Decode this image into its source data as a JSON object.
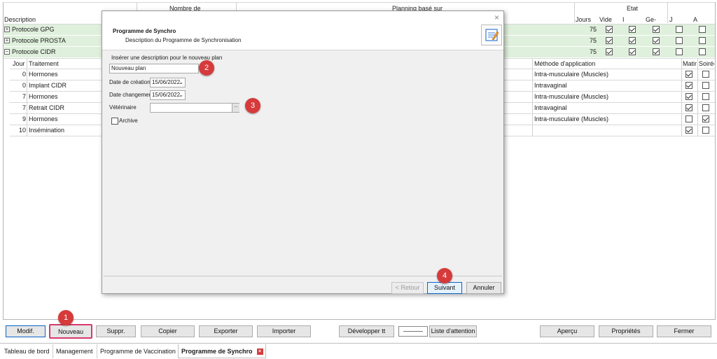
{
  "grid": {
    "top_headers": {
      "nombre_de": "Nombre de",
      "planning_base_sur": "Planning basé sur",
      "etat": "Etat"
    },
    "columns": {
      "description": "Description",
      "jours": "Jours",
      "vide": "Vide",
      "i": "I",
      "ge": "Ge-",
      "j": "J",
      "a": "A"
    },
    "protocols": [
      {
        "name": "Protocole GPG",
        "expander": "+",
        "jours": "75",
        "vide": true,
        "i": true,
        "ge": true,
        "j": false,
        "a": false
      },
      {
        "name": "Protocole PROSTA",
        "expander": "+",
        "jours": "75",
        "vide": true,
        "i": true,
        "ge": true,
        "j": false,
        "a": false
      },
      {
        "name": "Protocole CIDR",
        "expander": "−",
        "jours": "75",
        "vide": true,
        "i": true,
        "ge": true,
        "j": false,
        "a": false
      }
    ],
    "sub_columns": {
      "jour": "Jour",
      "traitement": "Traitement",
      "methode": "Méthode d'application",
      "matin": "Matin",
      "soiree": "Soirée"
    },
    "treatments": [
      {
        "jour": "0",
        "traitement": "Hormones",
        "methode": "Intra-musculaire (Muscles)",
        "matin": true,
        "soiree": false
      },
      {
        "jour": "0",
        "traitement": "Implant CIDR",
        "methode": "Intravaginal",
        "matin": true,
        "soiree": false
      },
      {
        "jour": "7",
        "traitement": "Hormones",
        "methode": "Intra-musculaire (Muscles)",
        "matin": true,
        "soiree": false
      },
      {
        "jour": "7",
        "traitement": "Retrait CIDR",
        "methode": "Intravaginal",
        "matin": true,
        "soiree": false
      },
      {
        "jour": "9",
        "traitement": "Hormones",
        "methode": "Intra-musculaire (Muscles)",
        "matin": false,
        "soiree": true
      },
      {
        "jour": "10",
        "traitement": "Insémination",
        "methode": "",
        "matin": true,
        "soiree": false
      }
    ]
  },
  "dialog": {
    "title": "Programme de Synchro",
    "subtitle": "Description du Programme de Synchronisation",
    "close_glyph": "×",
    "prompt": "Insérer une description pour le nouveau plan",
    "description_value": "Nouveau plan",
    "date_creation_label": "Date de création",
    "date_creation_value": "15/06/2022",
    "date_changement_label": "Date changement",
    "date_changement_value": "15/06/2022",
    "veterinaire_label": "Vétérinaire",
    "veterinaire_value": "",
    "browse_glyph": "...",
    "archive_label": "Archive",
    "btn_retour": "< Retour",
    "btn_suivant": "Suivant",
    "btn_annuler": "Annuler"
  },
  "toolbar": {
    "modif": "Modif.",
    "nouveau": "Nouveau",
    "suppr": "Suppr.",
    "copier": "Copier",
    "exporter": "Exporter",
    "importer": "Importer",
    "developper": "Développer tt",
    "liste": "Liste d'attention",
    "apercu": "Aperçu",
    "proprietes": "Propriétés",
    "fermer": "Fermer"
  },
  "tabs": [
    {
      "label": "Tableau de bord"
    },
    {
      "label": "Management"
    },
    {
      "label": "Programme de Vaccination"
    },
    {
      "label": "Programme de Synchro"
    }
  ],
  "markers": [
    "1",
    "2",
    "3",
    "4"
  ],
  "colors": {
    "accent": "#0a64c8",
    "marker": "#d63a3a",
    "highlight_row": "#dff0dc",
    "active_tab_close": "#d63a3a"
  }
}
